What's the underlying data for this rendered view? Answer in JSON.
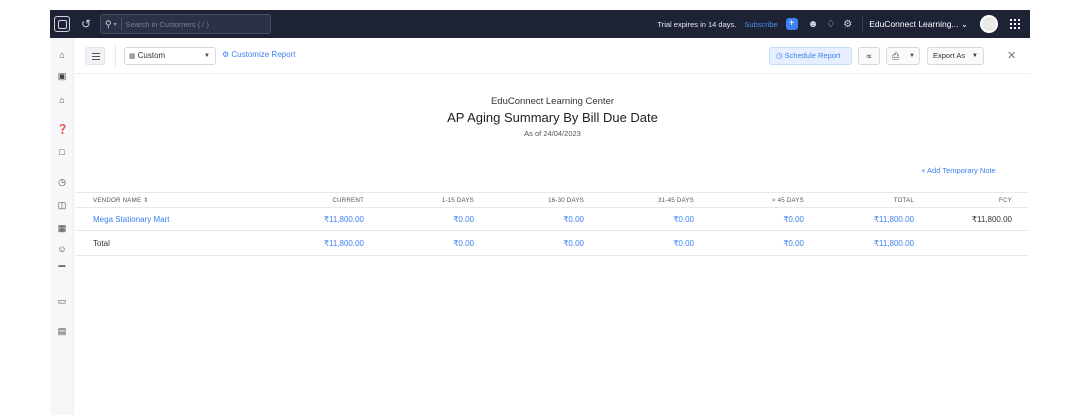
{
  "topbar": {
    "search_placeholder": "Search in Customers ( / )",
    "trial_text": "Trial expires in 14 days.",
    "subscribe_label": "Subscribe",
    "org_name": "EduConnect Learning...",
    "org_caret": "⌄"
  },
  "toolbar": {
    "custom_label": "Custom",
    "customize_label": "Customize Report",
    "schedule_label": "Schedule Report",
    "export_label": "Export As"
  },
  "report": {
    "org": "EduConnect Learning Center",
    "title": "AP Aging Summary By Bill Due Date",
    "as_of": "As of 24/04/2023",
    "add_note": "+ Add Temporary Note"
  },
  "table": {
    "headers": [
      "VENDOR NAME",
      "CURRENT",
      "1-15 DAYS",
      "16-30 DAYS",
      "31-45 DAYS",
      "> 45 DAYS",
      "TOTAL",
      "FCY"
    ],
    "rows": [
      {
        "vendor": "Mega Stationary Mart",
        "current": "₹11,800.00",
        "d1_15": "₹0.00",
        "d16_30": "₹0.00",
        "d31_45": "₹0.00",
        "d45": "₹0.00",
        "total": "₹11,800.00",
        "fcy": "₹11,800.00"
      }
    ],
    "total_row": {
      "label": "Total",
      "current": "₹11,800.00",
      "d1_15": "₹0.00",
      "d16_30": "₹0.00",
      "d31_45": "₹0.00",
      "d45": "₹0.00",
      "total": "₹11,800.00"
    }
  }
}
